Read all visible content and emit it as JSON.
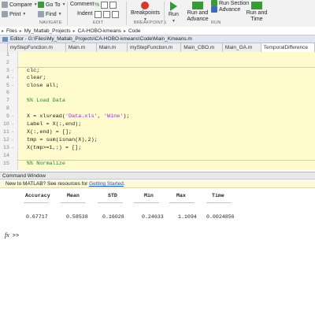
{
  "ribbon": {
    "compare": "Compare",
    "print": "Print",
    "goto": "Go To",
    "find": "Find",
    "comment": "Comment",
    "indent": "Indent",
    "comment_symbols": [
      "%",
      "%",
      "%"
    ],
    "breakpoints": "Breakpoints",
    "run": "Run",
    "run_and_advance": "Run and Advance",
    "run_section": "Run Section",
    "advance": "Advance",
    "run_and_time": "Run and Time",
    "sections": {
      "navigate": "NAVIGATE",
      "edit": "EDIT",
      "breakpoints": "BREAKPOINTS",
      "run": "RUN"
    }
  },
  "breadcrumb": [
    "Files",
    "My_Matlab_Projects",
    "CA-HOBO-kmeans",
    "Code"
  ],
  "editor": {
    "title": "Editor - G:\\Files\\My_Matlab_Projects\\CA-HOBO-kmeans\\Code\\Main_Kmeans.m",
    "tabs": [
      "myStepFunction.m",
      "Main.m",
      "Main.m",
      "myStepFunction.m",
      "Main_CBO.m",
      "Main_GA.m",
      "TemporalDifference"
    ],
    "lines": [
      {
        "n": "1",
        "text": ""
      },
      {
        "n": "2",
        "text": ""
      },
      {
        "n": "3",
        "text": "clc;"
      },
      {
        "n": "4",
        "text": "clear;"
      },
      {
        "n": "5",
        "text": "close all;"
      },
      {
        "n": "6",
        "text": ""
      },
      {
        "n": "7",
        "text": "%% Load Data"
      },
      {
        "n": "8",
        "text": ""
      },
      {
        "n": "9",
        "text_pre": "X = xlsread(",
        "str1": "'Data.xls'",
        "mid": ", ",
        "str2": "'Wine'",
        "text_post": ");"
      },
      {
        "n": "10",
        "text": "Label = X(:,end);"
      },
      {
        "n": "11",
        "text": "X(:,end) = [];"
      },
      {
        "n": "12",
        "text": "tmp = sum(isnan(X),2);"
      },
      {
        "n": "13",
        "text": "X(tmp>=1,:) = [];"
      },
      {
        "n": "14",
        "text": ""
      },
      {
        "n": "15",
        "text": "%% Normalize"
      }
    ]
  },
  "command_window": {
    "title": "Command Window",
    "notice_text": "New to MATLAB? See resources for ",
    "notice_link": "Getting Started",
    "notice_end": ".",
    "headers": [
      "Accuracy",
      "Mean",
      "STD",
      "Min",
      "Max",
      "Time"
    ],
    "underline": "________",
    "values": [
      "0.67717",
      "0.58538",
      "0.16028",
      "0.24633",
      "1.1094",
      "0.0024856"
    ],
    "prompt_fx": "fx",
    "prompt": ">>"
  }
}
